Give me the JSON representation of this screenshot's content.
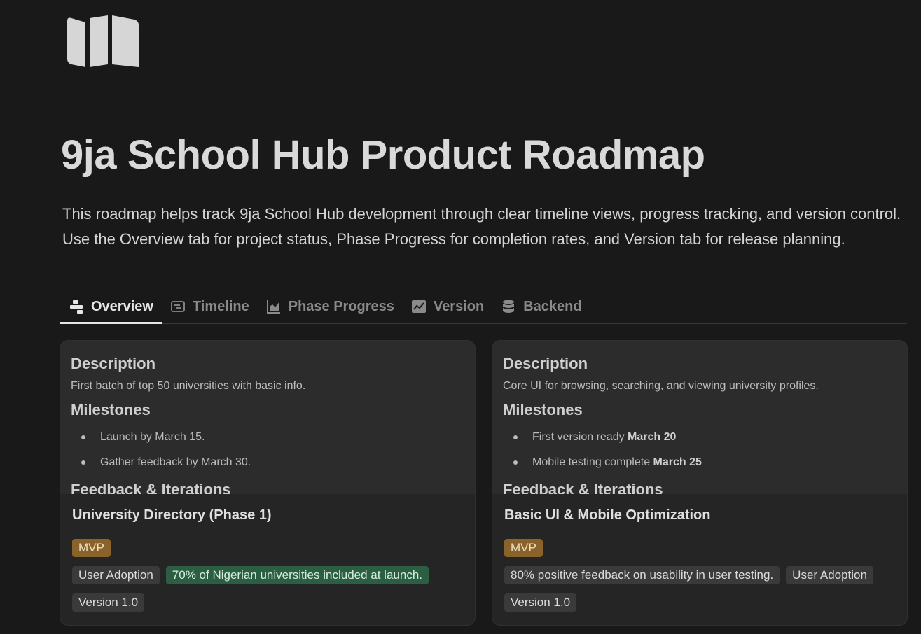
{
  "page": {
    "icon": "map-icon",
    "title": "9ja School Hub Product Roadmap",
    "description": "This roadmap helps track 9ja School Hub development through clear timeline views, progress tracking, and version control. Use the Overview tab for project status, Phase Progress for completion rates, and Version tab for release planning."
  },
  "tabs": [
    {
      "label": "Overview",
      "icon": "board-icon",
      "active": true
    },
    {
      "label": "Timeline",
      "icon": "timeline-icon",
      "active": false
    },
    {
      "label": "Phase Progress",
      "icon": "chart-icon",
      "active": false
    },
    {
      "label": "Version",
      "icon": "line-chart-icon",
      "active": false
    },
    {
      "label": "Backend",
      "icon": "database-icon",
      "active": false
    }
  ],
  "cards": [
    {
      "preview": {
        "description_heading": "Description",
        "description_text": "First batch of top 50 universities with basic info.",
        "milestones_heading": "Milestones",
        "milestones": [
          {
            "text": "Launch by March 15.",
            "bold": ""
          },
          {
            "text": "Gather feedback by March 30.",
            "bold": ""
          }
        ],
        "feedback_heading": "Feedback & Iterations"
      },
      "title": "University Directory (Phase 1)",
      "tags": {
        "phase": "MVP",
        "goal": "User Adoption",
        "metric": "70% of Nigerian universities included at launch.",
        "version": "Version 1.0"
      }
    },
    {
      "preview": {
        "description_heading": "Description",
        "description_text": "Core UI for browsing, searching, and viewing university profiles.",
        "milestones_heading": "Milestones",
        "milestones": [
          {
            "text": "First version ready ",
            "bold": "March 20"
          },
          {
            "text": "Mobile testing complete ",
            "bold": "March 25"
          }
        ],
        "feedback_heading": "Feedback & Iterations"
      },
      "title": "Basic UI & Mobile Optimization",
      "tags": {
        "phase": "MVP",
        "metric": "80% positive feedback on usability in user testing.",
        "goal": "User Adoption",
        "version": "Version 1.0"
      }
    }
  ],
  "colors": {
    "background": "#191919",
    "card": "#252525",
    "mvp_tag": "#89632a",
    "green_tag": "#2b5e42",
    "gray_tag": "#3a3a3a"
  }
}
